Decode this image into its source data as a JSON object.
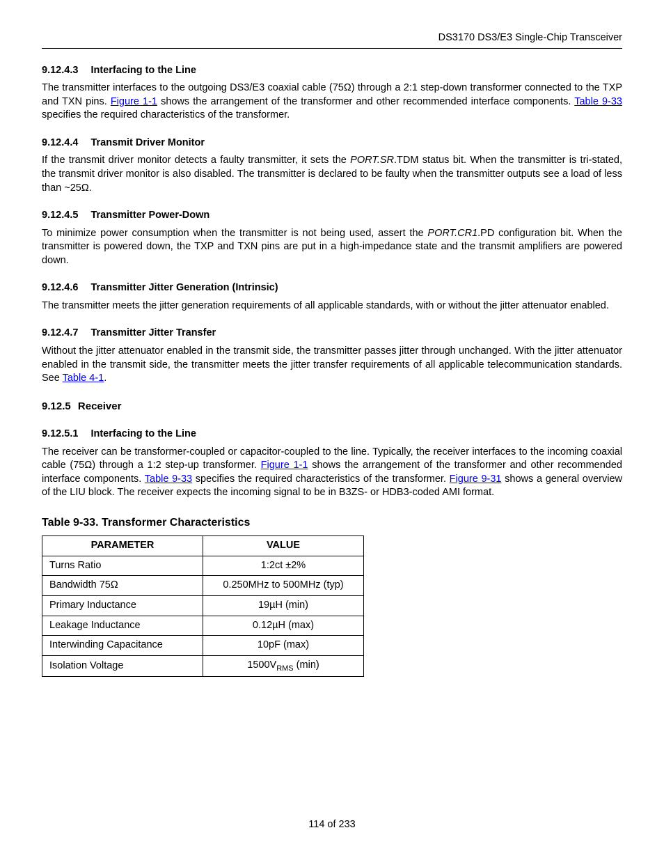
{
  "header": "DS3170 DS3/E3 Single-Chip Transceiver",
  "s1": {
    "num": "9.12.4.3",
    "title": "Interfacing to the Line",
    "p_a": "The transmitter interfaces to the outgoing DS3/E3 coaxial cable (75Ω) through a 2:1 step-down transformer connected to the TXP and TXN pins. ",
    "link1": "Figure 1-1",
    "p_b": " shows the arrangement of the transformer and other recommended interface components. ",
    "link2": "Table 9-33",
    "p_c": " specifies the required characteristics of the transformer."
  },
  "s2": {
    "num": "9.12.4.4",
    "title": "Transmit Driver Monitor",
    "p_a": "If the transmit driver monitor detects a faulty transmitter, it sets the ",
    "em": "PORT.SR",
    "p_b": ".TDM status bit.  When the transmitter is tri-stated, the transmit driver monitor is also disabled. The transmitter is declared to be faulty when the transmitter outputs see a load of less than ~25Ω."
  },
  "s3": {
    "num": "9.12.4.5",
    "title": "Transmitter Power-Down",
    "p_a": "To minimize power consumption when the transmitter is not being used, assert the ",
    "em": "PORT.CR1",
    "p_b": ".PD configuration bit. When the transmitter is powered down, the TXP and TXN pins are put in a high-impedance state and the transmit amplifiers are powered down."
  },
  "s4": {
    "num": "9.12.4.6",
    "title": "Transmitter Jitter Generation (Intrinsic)",
    "p": "The transmitter meets the jitter generation requirements of all applicable standards, with or without the jitter attenuator enabled."
  },
  "s5": {
    "num": "9.12.4.7",
    "title": "Transmitter Jitter Transfer",
    "p_a": "Without the jitter attenuator enabled in the transmit side, the transmitter passes jitter through unchanged. With the jitter attenuator enabled in the transmit side, the transmitter meets the jitter transfer requirements of all applicable telecommunication standards.  See ",
    "link1": "Table 4-1",
    "p_b": "."
  },
  "s6": {
    "num": "9.12.5",
    "title": "Receiver"
  },
  "s7": {
    "num": "9.12.5.1",
    "title": "Interfacing to the Line",
    "p_a": "The receiver can be transformer-coupled or capacitor-coupled to the line. Typically, the receiver interfaces to the incoming coaxial cable (75Ω) through a 1:2 step-up transformer. ",
    "link1": "Figure 1-1",
    "p_b": " shows the arrangement of the transformer and other recommended interface components. ",
    "link2": "Table 9-33",
    "p_c": " specifies the required characteristics of the transformer. ",
    "link3": "Figure 9-31",
    "p_d": " shows a general overview of the LIU block. The receiver expects the incoming signal to be in B3ZS- or HDB3-coded AMI format."
  },
  "table": {
    "title": "Table 9-33. Transformer Characteristics",
    "h1": "PARAMETER",
    "h2": "VALUE",
    "rows": [
      {
        "p": "Turns Ratio",
        "v": "1:2ct ±2%"
      },
      {
        "p": "Bandwidth 75Ω",
        "v": "0.250MHz to 500MHz (typ)"
      },
      {
        "p": "Primary Inductance",
        "v": "19µH (min)"
      },
      {
        "p": "Leakage Inductance",
        "v": "0.12µH (max)"
      },
      {
        "p": "Interwinding Capacitance",
        "v": "10pF (max)"
      },
      {
        "p": "Isolation Voltage",
        "v_pre": "1500V",
        "v_sub": "RMS",
        "v_post": " (min)"
      }
    ]
  },
  "footer": "114 of 233"
}
